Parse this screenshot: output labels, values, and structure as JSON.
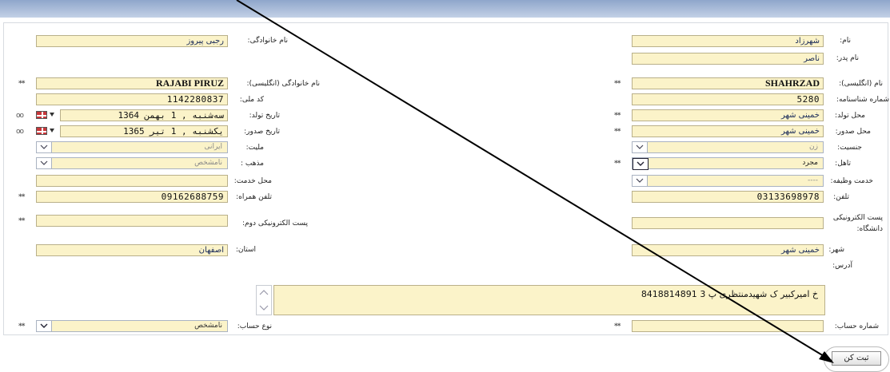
{
  "left": {
    "last_name_label": "نام خانوادگی:",
    "last_name_value": "رجبی پیروز",
    "last_name_en_label": "نام خانوادگی (انگلیسی):",
    "last_name_en_value": "RAJABI PIRUZ",
    "national_code_label": "کد ملی:",
    "national_code_value": "1142280837",
    "birth_date_label": "تاریخ تولد:",
    "birth_date_value": "سه‌شنبه , 1 بهمن 1364",
    "issue_date_label": "تاریخ صدور:",
    "issue_date_value": "یکشنبه , 1 تیر 1365",
    "nationality_label": "ملیت:",
    "nationality_value": "ایرانی",
    "religion_label": "مذهب :",
    "religion_value": "نامشخص",
    "service_place_label": "محل خدمت:",
    "service_place_value": "",
    "mobile_label": "تلفن همراه:",
    "mobile_value": "09162688759",
    "second_email_label": "پست الکترونیکی دوم:",
    "second_email_value": "",
    "province_label": "استان:",
    "province_value": "اصفهان",
    "account_type_label": "نوع حساب:",
    "account_type_value": "نامشخص"
  },
  "right": {
    "first_name_label": "نام:",
    "first_name_value": "شهرزاد",
    "father_name_label": "نام پدر:",
    "father_name_value": "ناصر",
    "first_name_en_label": "نام (انگلیسی):",
    "first_name_en_value": "SHAHRZAD",
    "id_number_label": "شماره شناسنامه:",
    "id_number_value": "5280",
    "birth_place_label": "محل تولد:",
    "birth_place_value": "خمینی شهر",
    "issue_place_label": "محل صدور:",
    "issue_place_value": "خمینی شهر",
    "gender_label": "جنسیت:",
    "gender_value": "زن",
    "marital_label": "تاهل:",
    "marital_value": "مجرد",
    "duty_label": "خدمت وظیفه:",
    "duty_value": "----",
    "phone_label": "تلفن:",
    "phone_value": "03133698978",
    "uni_email_label": "پست الکترونیکی دانشگاه:",
    "uni_email_value": "",
    "city_label": "شهر:",
    "city_value": "خمینی شهر",
    "address_label": "آدرس:",
    "address_value": "خ امیرکبیر ک شهیدمنتظری پ 3 8418814891",
    "account_no_label": "شماره حساب:",
    "account_no_value": ""
  },
  "marks": {
    "required": "**",
    "calendar_extra": "oo"
  },
  "submit_label": "ثبت کن",
  "colors": {
    "field_bg": "#fbf3c9",
    "header_blue": "#8fa6cb",
    "annotation_arrow": "#000000"
  },
  "icons": [
    "calendar-flag-icon",
    "dropdown-caret-icon",
    "scroll-up-icon",
    "scroll-down-icon",
    "annotation-arrow"
  ]
}
